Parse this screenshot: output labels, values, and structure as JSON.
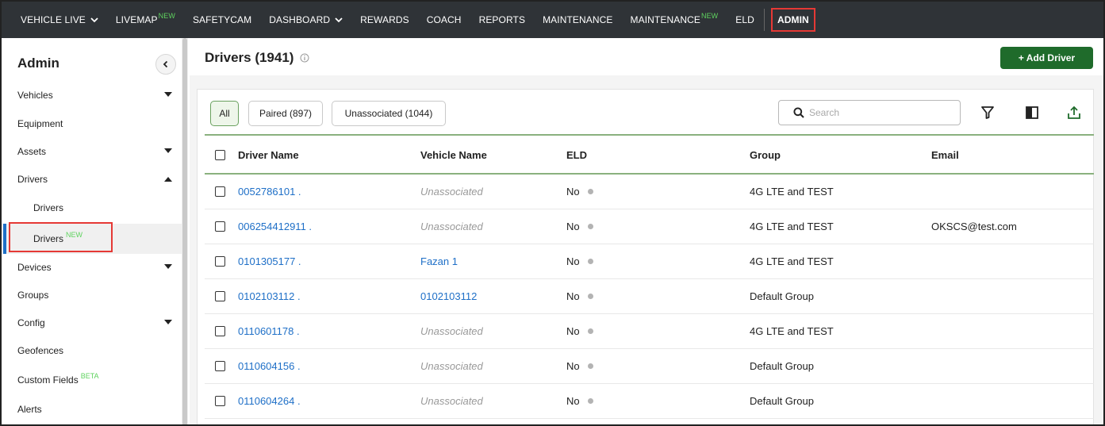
{
  "topnav": {
    "items": [
      {
        "label": "VEHICLE LIVE",
        "new": "",
        "has_menu": true
      },
      {
        "label": "LIVEMAP",
        "new": "NEW",
        "has_menu": false
      },
      {
        "label": "SAFETYCAM",
        "new": "",
        "has_menu": false
      },
      {
        "label": "DASHBOARD",
        "new": "",
        "has_menu": true
      },
      {
        "label": "REWARDS",
        "new": "",
        "has_menu": false
      },
      {
        "label": "COACH",
        "new": "",
        "has_menu": false
      },
      {
        "label": "REPORTS",
        "new": "",
        "has_menu": false
      },
      {
        "label": "MAINTENANCE",
        "new": "",
        "has_menu": false
      },
      {
        "label": "MAINTENANCE",
        "new": "NEW",
        "has_menu": false
      },
      {
        "label": "ELD",
        "new": "",
        "has_menu": false
      }
    ],
    "admin_label": "ADMIN",
    "new_color": "#5fd35f",
    "highlight_color": "#e53935"
  },
  "sidebar": {
    "title": "Admin",
    "collapse_icon": "chevron-left-icon",
    "items": [
      {
        "label": "Vehicles",
        "caret": "down",
        "tag": ""
      },
      {
        "label": "Equipment",
        "caret": "",
        "tag": ""
      },
      {
        "label": "Assets",
        "caret": "down",
        "tag": ""
      },
      {
        "label": "Drivers",
        "caret": "up",
        "tag": ""
      },
      {
        "label": "Drivers",
        "caret": "",
        "tag": "",
        "sub": true
      },
      {
        "label": "Drivers",
        "caret": "",
        "tag": "NEW",
        "sub": true,
        "active": true
      },
      {
        "label": "Devices",
        "caret": "down",
        "tag": ""
      },
      {
        "label": "Groups",
        "caret": "",
        "tag": ""
      },
      {
        "label": "Config",
        "caret": "down",
        "tag": ""
      },
      {
        "label": "Geofences",
        "caret": "",
        "tag": ""
      },
      {
        "label": "Custom Fields",
        "caret": "",
        "tag": "BETA"
      },
      {
        "label": "Alerts",
        "caret": "",
        "tag": ""
      }
    ]
  },
  "main": {
    "title": "Drivers (1941)",
    "add_button": "+ Add Driver",
    "accent_color": "#1f6b2b",
    "filters": [
      "All",
      "Paired (897)",
      "Unassociated (1044)"
    ],
    "search_placeholder": "Search",
    "tools": [
      "filter-icon",
      "columns-icon",
      "export-icon"
    ],
    "columns": [
      "Driver Name",
      "Vehicle Name",
      "ELD",
      "Group",
      "Email"
    ],
    "rows": [
      {
        "driver": "0052786101 .",
        "vehicle": "Unassociated",
        "vehicle_linked": false,
        "eld": "No",
        "group": "4G LTE and TEST",
        "email": ""
      },
      {
        "driver": "006254412911 .",
        "vehicle": "Unassociated",
        "vehicle_linked": false,
        "eld": "No",
        "group": "4G LTE and TEST",
        "email": "OKSCS@test.com"
      },
      {
        "driver": "0101305177 .",
        "vehicle": "Fazan 1",
        "vehicle_linked": true,
        "eld": "No",
        "group": "4G LTE and TEST",
        "email": ""
      },
      {
        "driver": "0102103112 .",
        "vehicle": "0102103112",
        "vehicle_linked": true,
        "eld": "No",
        "group": "Default Group",
        "email": ""
      },
      {
        "driver": "0110601178 .",
        "vehicle": "Unassociated",
        "vehicle_linked": false,
        "eld": "No",
        "group": "4G LTE and TEST",
        "email": ""
      },
      {
        "driver": "0110604156 .",
        "vehicle": "Unassociated",
        "vehicle_linked": false,
        "eld": "No",
        "group": "Default Group",
        "email": ""
      },
      {
        "driver": "0110604264 .",
        "vehicle": "Unassociated",
        "vehicle_linked": false,
        "eld": "No",
        "group": "Default Group",
        "email": ""
      }
    ]
  }
}
